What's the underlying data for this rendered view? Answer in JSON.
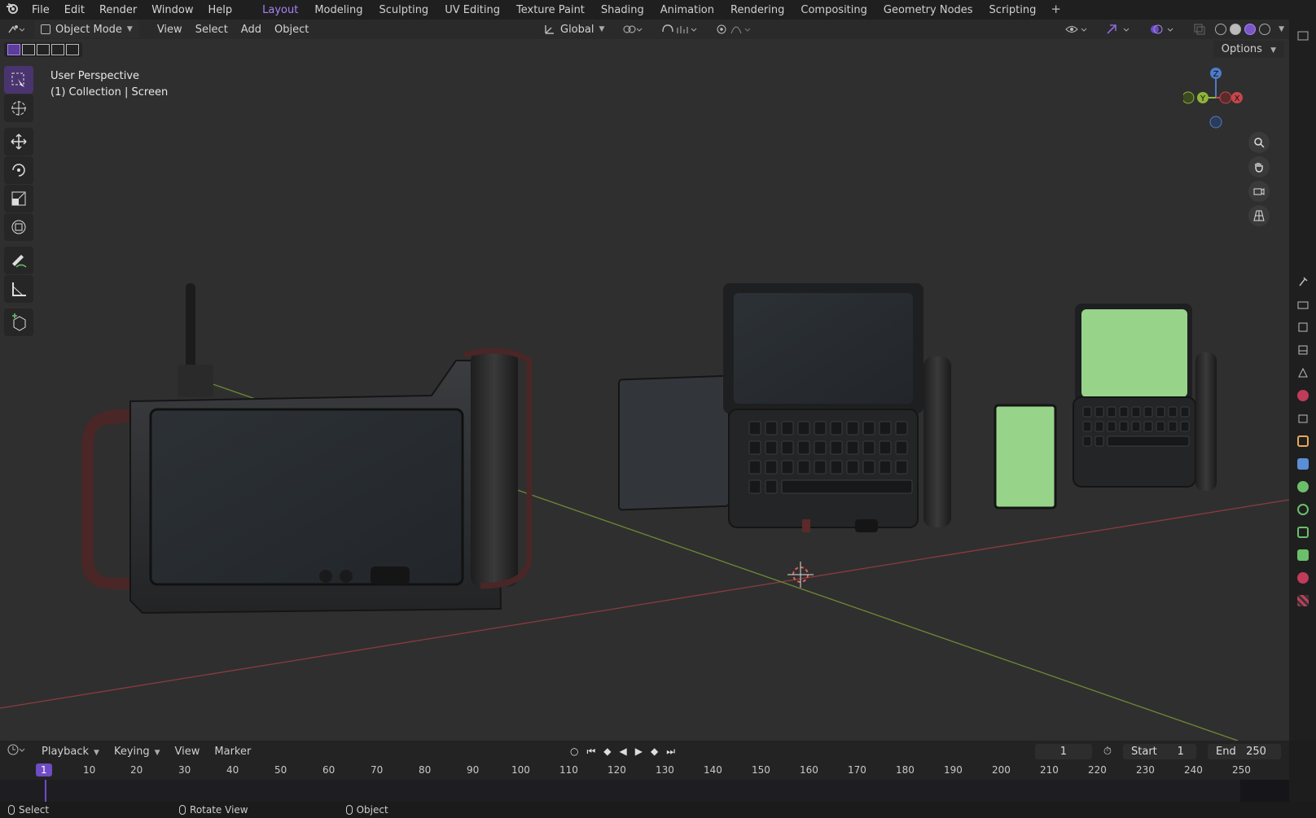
{
  "app": {
    "logo": "blender-logo-icon"
  },
  "menu": [
    "File",
    "Edit",
    "Render",
    "Window",
    "Help"
  ],
  "workspaces": [
    "Layout",
    "Modeling",
    "Sculpting",
    "UV Editing",
    "Texture Paint",
    "Shading",
    "Animation",
    "Rendering",
    "Compositing",
    "Geometry Nodes",
    "Scripting"
  ],
  "workspace_active": "Layout",
  "workspace_add": "+",
  "header": {
    "mode": "Object Mode",
    "menus": [
      "View",
      "Select",
      "Add",
      "Object"
    ],
    "orientation": "Global"
  },
  "viewport": {
    "options_label": "Options",
    "perspective": "User Perspective",
    "collection": "(1) Collection | Screen",
    "gizmo_axes": {
      "z": "Z",
      "y": "Y",
      "x": "X"
    },
    "colors": {
      "x_axis": "#c8464a",
      "y_axis": "#8fb43a",
      "z_axis": "#4d7bc9",
      "accent": "#a883f5",
      "screen_green": "#97d48a"
    }
  },
  "toolbar_tools": [
    "select-box-icon",
    "cursor-icon",
    "move-icon",
    "rotate-icon",
    "scale-icon",
    "transform-icon",
    "annotate-icon",
    "measure-icon",
    "add-cube-icon"
  ],
  "timeline": {
    "menus": [
      "Playback",
      "Keying",
      "View",
      "Marker"
    ],
    "current_frame": "1",
    "start_label": "Start",
    "start": "1",
    "end_label": "End",
    "end": "250",
    "ticks": [
      "1",
      "10",
      "20",
      "30",
      "40",
      "50",
      "60",
      "70",
      "80",
      "90",
      "100",
      "110",
      "120",
      "130",
      "140",
      "150",
      "160",
      "170",
      "180",
      "190",
      "200",
      "210",
      "220",
      "230",
      "240",
      "250"
    ]
  },
  "status": {
    "select": "Select",
    "rotate": "Rotate View",
    "object": "Object"
  }
}
